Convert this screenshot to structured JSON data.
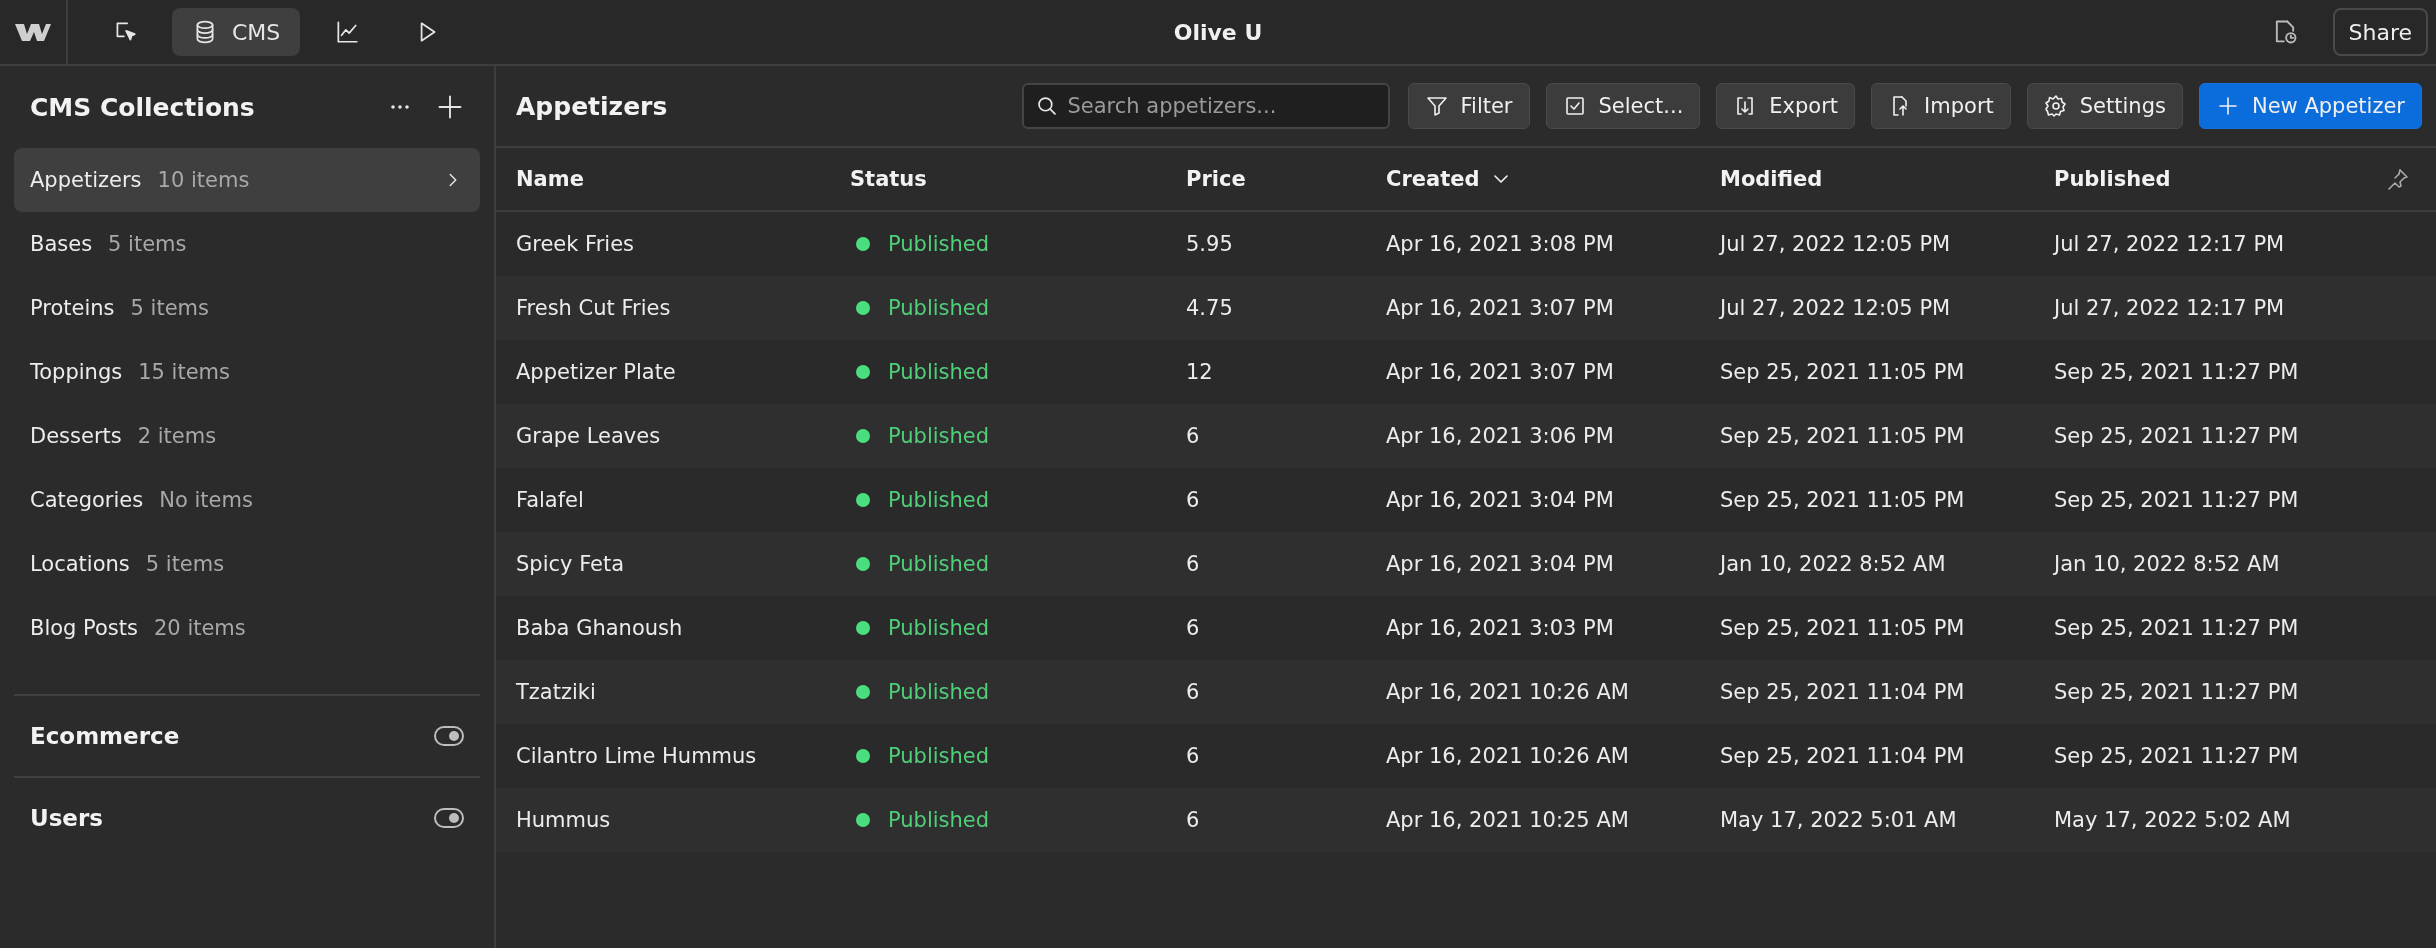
{
  "topbar": {
    "title": "Olive U",
    "nav": [
      {
        "kind": "designer",
        "selected": false
      },
      {
        "kind": "cms",
        "label": "CMS",
        "selected": true
      },
      {
        "kind": "analytics",
        "selected": false
      },
      {
        "kind": "preview",
        "selected": false
      }
    ],
    "share": "Share"
  },
  "sidebar": {
    "title": "CMS Collections",
    "collections": [
      {
        "name": "Appetizers",
        "count": "10 items",
        "selected": true
      },
      {
        "name": "Bases",
        "count": "5 items",
        "selected": false
      },
      {
        "name": "Proteins",
        "count": "5 items",
        "selected": false
      },
      {
        "name": "Toppings",
        "count": "15 items",
        "selected": false
      },
      {
        "name": "Desserts",
        "count": "2 items",
        "selected": false
      },
      {
        "name": "Categories",
        "count": "No items",
        "selected": false
      },
      {
        "name": "Locations",
        "count": "5 items",
        "selected": false
      },
      {
        "name": "Blog Posts",
        "count": "20 items",
        "selected": false
      }
    ],
    "sections": [
      {
        "title": "Ecommerce",
        "on": true
      },
      {
        "title": "Users",
        "on": true
      }
    ]
  },
  "main": {
    "title": "Appetizers",
    "search": {
      "placeholder": "Search appetizers..."
    },
    "actions": [
      {
        "kind": "filter",
        "label": "Filter"
      },
      {
        "kind": "select",
        "label": "Select..."
      },
      {
        "kind": "export",
        "label": "Export"
      },
      {
        "kind": "import",
        "label": "Import"
      },
      {
        "kind": "settings",
        "label": "Settings"
      },
      {
        "kind": "primary",
        "label": "New Appetizer"
      }
    ],
    "table": {
      "columns": [
        {
          "label": "Name",
          "sorted": false
        },
        {
          "label": "Status",
          "sorted": false
        },
        {
          "label": "Price",
          "sorted": false
        },
        {
          "label": "Created",
          "sorted": true
        },
        {
          "label": "Modified",
          "sorted": false
        },
        {
          "label": "Published",
          "sorted": false
        }
      ],
      "rows": [
        {
          "name": "Greek Fries",
          "status": "Published",
          "color": "#4ade80",
          "price": "5.95",
          "created": "Apr 16, 2021 3:08 PM",
          "modified": "Jul 27, 2022 12:05 PM",
          "published": "Jul 27, 2022 12:17 PM"
        },
        {
          "name": "Fresh Cut Fries",
          "status": "Published",
          "color": "#4ade80",
          "price": "4.75",
          "created": "Apr 16, 2021 3:07 PM",
          "modified": "Jul 27, 2022 12:05 PM",
          "published": "Jul 27, 2022 12:17 PM"
        },
        {
          "name": "Appetizer Plate",
          "status": "Published",
          "color": "#4ade80",
          "price": "12",
          "created": "Apr 16, 2021 3:07 PM",
          "modified": "Sep 25, 2021 11:05 PM",
          "published": "Sep 25, 2021 11:27 PM"
        },
        {
          "name": "Grape Leaves",
          "status": "Published",
          "color": "#4ade80",
          "price": "6",
          "created": "Apr 16, 2021 3:06 PM",
          "modified": "Sep 25, 2021 11:05 PM",
          "published": "Sep 25, 2021 11:27 PM"
        },
        {
          "name": "Falafel",
          "status": "Published",
          "color": "#4ade80",
          "price": "6",
          "created": "Apr 16, 2021 3:04 PM",
          "modified": "Sep 25, 2021 11:05 PM",
          "published": "Sep 25, 2021 11:27 PM"
        },
        {
          "name": "Spicy Feta",
          "status": "Published",
          "color": "#4ade80",
          "price": "6",
          "created": "Apr 16, 2021 3:04 PM",
          "modified": "Jan 10, 2022 8:52 AM",
          "published": "Jan 10, 2022 8:52 AM"
        },
        {
          "name": "Baba Ghanoush",
          "status": "Published",
          "color": "#4ade80",
          "price": "6",
          "created": "Apr 16, 2021 3:03 PM",
          "modified": "Sep 25, 2021 11:05 PM",
          "published": "Sep 25, 2021 11:27 PM"
        },
        {
          "name": "Tzatziki",
          "status": "Published",
          "color": "#4ade80",
          "price": "6",
          "created": "Apr 16, 2021 10:26 AM",
          "modified": "Sep 25, 2021 11:04 PM",
          "published": "Sep 25, 2021 11:27 PM"
        },
        {
          "name": "Cilantro Lime Hummus",
          "status": "Published",
          "color": "#4ade80",
          "price": "6",
          "created": "Apr 16, 2021 10:26 AM",
          "modified": "Sep 25, 2021 11:04 PM",
          "published": "Sep 25, 2021 11:27 PM"
        },
        {
          "name": "Hummus",
          "status": "Published",
          "color": "#4ade80",
          "price": "6",
          "created": "Apr 16, 2021 10:25 AM",
          "modified": "May 17, 2022 5:01 AM",
          "published": "May 17, 2022 5:02 AM"
        }
      ]
    }
  }
}
